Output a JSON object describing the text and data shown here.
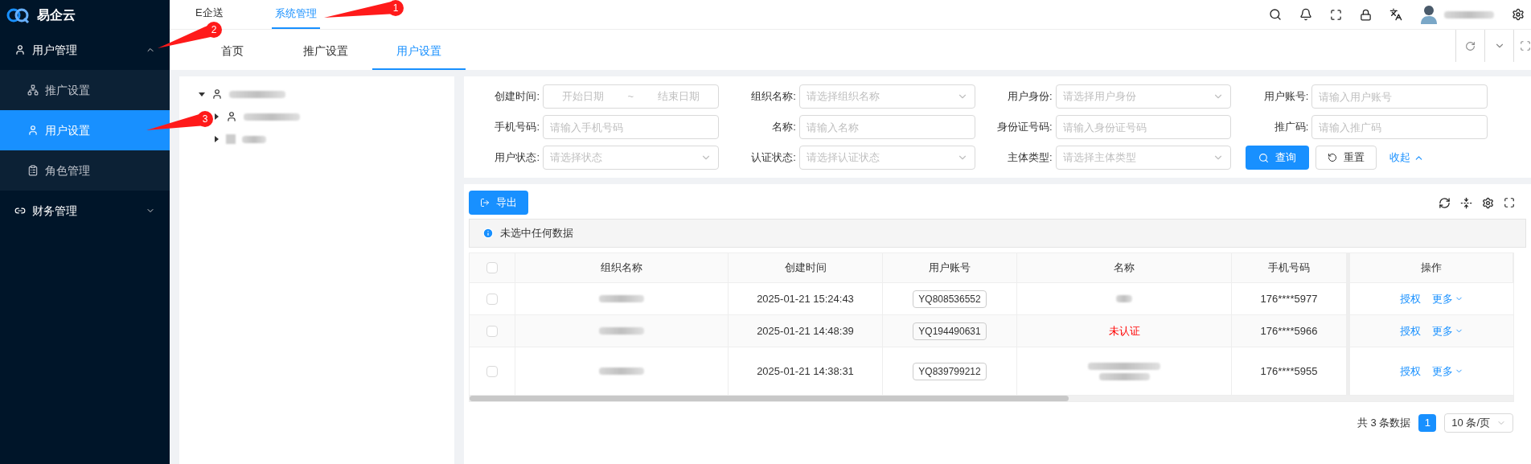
{
  "app": {
    "name": "易企云"
  },
  "sidebar": {
    "items": [
      {
        "label": "用户管理",
        "expanded": true,
        "children": [
          {
            "label": "推广设置",
            "selected": false
          },
          {
            "label": "用户设置",
            "selected": true
          },
          {
            "label": "角色管理",
            "selected": false
          }
        ]
      },
      {
        "label": "财务管理",
        "expanded": false
      }
    ]
  },
  "top_tabs": [
    {
      "label": "E企送",
      "selected": false
    },
    {
      "label": "系统管理",
      "selected": true
    }
  ],
  "page_tabs": [
    {
      "label": "首页",
      "selected": false
    },
    {
      "label": "推广设置",
      "selected": false
    },
    {
      "label": "用户设置",
      "selected": true
    }
  ],
  "tree": [
    {
      "expanded": true,
      "children": [
        {
          "expanded": false
        },
        {
          "expanded": false
        }
      ]
    }
  ],
  "filters": [
    {
      "label": "创建时间:",
      "kind": "daterange",
      "placeholder": "开始日期",
      "placeholder_end": "结束日期",
      "separator": "~"
    },
    {
      "label": "组织名称:",
      "kind": "select",
      "placeholder": "请选择组织名称"
    },
    {
      "label": "用户身份:",
      "kind": "select",
      "placeholder": "请选择用户身份"
    },
    {
      "label": "用户账号:",
      "kind": "input",
      "placeholder": "请输入用户账号"
    },
    {
      "label": "手机号码:",
      "kind": "input",
      "placeholder": "请输入手机号码"
    },
    {
      "label": "名称:",
      "kind": "input",
      "placeholder": "请输入名称"
    },
    {
      "label": "身份证号码:",
      "kind": "input",
      "placeholder": "请输入身份证号码"
    },
    {
      "label": "推广码:",
      "kind": "input",
      "placeholder": "请输入推广码"
    },
    {
      "label": "用户状态:",
      "kind": "select",
      "placeholder": "请选择状态"
    },
    {
      "label": "认证状态:",
      "kind": "select",
      "placeholder": "请选择认证状态"
    },
    {
      "label": "主体类型:",
      "kind": "select",
      "placeholder": "请选择主体类型"
    }
  ],
  "filter_actions": {
    "search": "查询",
    "reset": "重置",
    "collapse": "收起"
  },
  "toolbar": {
    "export": "导出"
  },
  "alert": "未选中任何数据",
  "table": {
    "columns": [
      "组织名称",
      "创建时间",
      "用户账号",
      "名称",
      "手机号码",
      "操作"
    ],
    "select_all": {
      "checked": false
    },
    "rows": [
      {
        "checked": false,
        "org": {
          "kind": "redacted"
        },
        "created": "2025-01-21 15:24:43",
        "account": "YQ808536552",
        "name": {
          "kind": "redacted"
        },
        "phone": "176****5977",
        "actions": [
          "授权",
          "更多"
        ]
      },
      {
        "checked": false,
        "org": {
          "kind": "redacted"
        },
        "created": "2025-01-21 14:48:39",
        "account": "YQ194490631",
        "name": {
          "kind": "status",
          "text": "未认证"
        },
        "phone": "176****5966",
        "actions": [
          "授权",
          "更多"
        ]
      },
      {
        "checked": false,
        "org": {
          "kind": "redacted"
        },
        "created": "2025-01-21 14:38:31",
        "account": "YQ839799212",
        "name": {
          "kind": "redacted_long"
        },
        "phone": "176****5955",
        "actions": [
          "授权",
          "更多"
        ]
      }
    ]
  },
  "pagination": {
    "total": "共 3 条数据",
    "pages": [
      {
        "label": "1",
        "selected": true
      }
    ],
    "page_size": "10 条/页"
  },
  "annotations": [
    {
      "label": "1"
    },
    {
      "label": "2"
    },
    {
      "label": "3"
    }
  ]
}
